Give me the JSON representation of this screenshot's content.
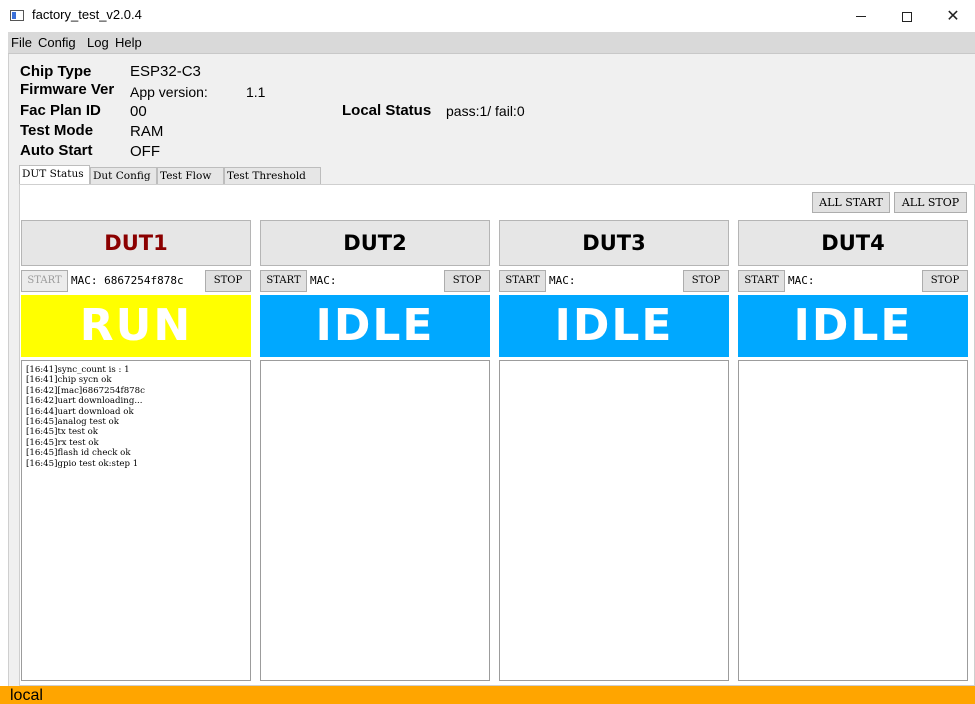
{
  "window": {
    "title": "factory_test_v2.0.4",
    "minimize_glyph": "—",
    "close_glyph": "✕"
  },
  "menu": [
    "File",
    "Config",
    "Log",
    "Help"
  ],
  "info": {
    "chip_type_label": "Chip Type",
    "chip_type_value": "ESP32-C3",
    "firmware_label": "Firmware Ver",
    "app_version_label": "App version:",
    "app_version_value": "1.1",
    "fac_plan_label": "Fac Plan ID",
    "fac_plan_value": "00",
    "test_mode_label": "Test Mode",
    "test_mode_value": "RAM",
    "auto_start_label": "Auto Start",
    "auto_start_value": "OFF",
    "local_status_label": "Local Status",
    "local_status_value": "pass:1/ fail:0"
  },
  "tabs": [
    "DUT Status",
    "Dut Config",
    "Test Flow",
    "Test Threshold"
  ],
  "toolbar": {
    "all_start": "ALL START",
    "all_stop": "ALL STOP"
  },
  "duts": [
    {
      "name": "DUT1",
      "start_label": "START",
      "stop_label": "STOP",
      "mac": "MAC: 6867254f878c",
      "status": "RUN",
      "status_color": "#ffff00",
      "log": [
        "[16:41]sync_count is : 1",
        "[16:41]chip sycn ok",
        "[16:42][mac]6867254f878c",
        "[16:42]uart downloading...",
        "[16:44]uart download ok",
        "[16:45]analog test ok",
        "[16:45]tx test ok",
        "[16:45]rx test ok",
        "[16:45]flash id check ok",
        "[16:45]gpio test ok:step 1"
      ]
    },
    {
      "name": "DUT2",
      "start_label": "START",
      "stop_label": "STOP",
      "mac": "MAC:",
      "status": "IDLE",
      "status_color": "#00a8ff",
      "log": []
    },
    {
      "name": "DUT3",
      "start_label": "START",
      "stop_label": "STOP",
      "mac": "MAC:",
      "status": "IDLE",
      "status_color": "#00a8ff",
      "log": []
    },
    {
      "name": "DUT4",
      "start_label": "START",
      "stop_label": "STOP",
      "mac": "MAC:",
      "status": "IDLE",
      "status_color": "#00a8ff",
      "log": []
    }
  ],
  "footer": {
    "text": "local",
    "color": "#ffa500"
  }
}
